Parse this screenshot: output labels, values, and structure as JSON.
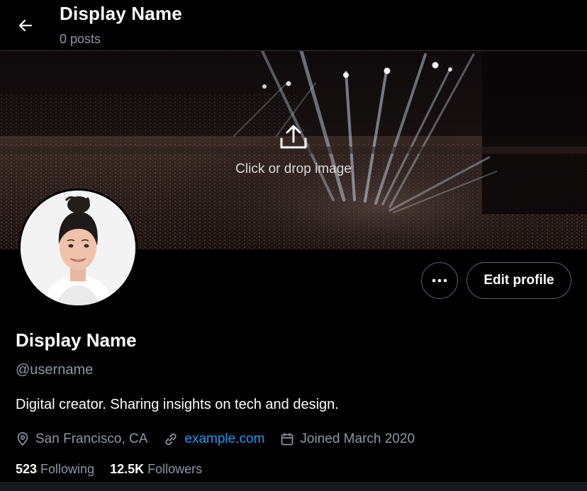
{
  "header": {
    "title": "Display Name",
    "posts_count": "0 posts"
  },
  "banner": {
    "upload_label": "Click or drop image"
  },
  "actions": {
    "edit_profile_label": "Edit profile"
  },
  "profile": {
    "display_name": "Display Name",
    "username": "@username",
    "bio": "Digital creator. Sharing insights on tech and design.",
    "location": "San Francisco, CA",
    "website": "example.com",
    "joined": "Joined March 2020"
  },
  "stats": {
    "following_count": "523",
    "following_label": "Following",
    "followers_count": "12.5K",
    "followers_label": "Followers"
  },
  "icons": {
    "back": "arrow-left-icon",
    "upload": "upload-icon",
    "more": "more-horizontal-icon",
    "location": "location-pin-icon",
    "link": "link-icon",
    "calendar": "calendar-icon"
  },
  "colors": {
    "background": "#000000",
    "link": "#1d9bf0",
    "secondary_text": "#8b98a5",
    "border": "#536471"
  }
}
